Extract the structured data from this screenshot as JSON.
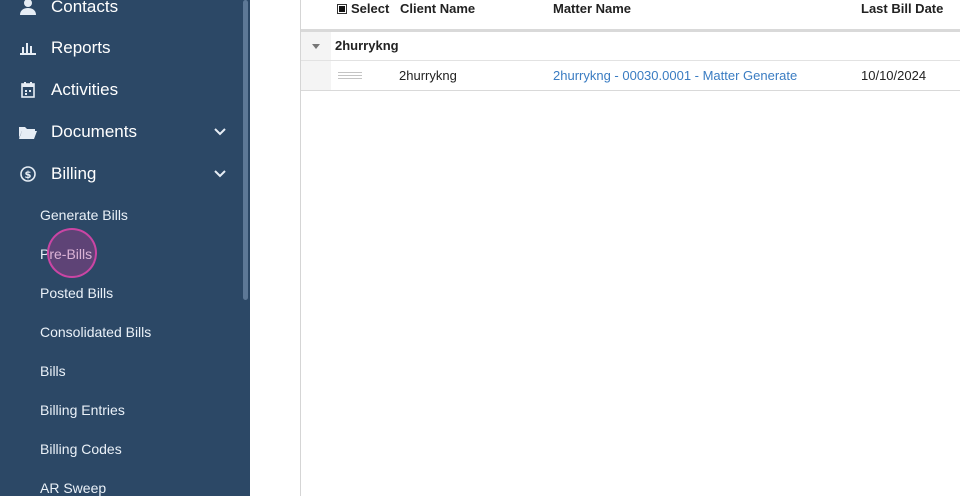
{
  "sidebar": {
    "nav_items": [
      {
        "label": "Contacts",
        "icon": "contacts-icon"
      },
      {
        "label": "Reports",
        "icon": "reports-icon"
      },
      {
        "label": "Activities",
        "icon": "activities-icon"
      },
      {
        "label": "Documents",
        "icon": "folder-icon",
        "expandable": true
      },
      {
        "label": "Billing",
        "icon": "billing-icon",
        "expandable": true
      }
    ],
    "billing_subitems": [
      "Generate Bills",
      "Pre-Bills",
      "Posted Bills",
      "Consolidated Bills",
      "Bills",
      "Billing Entries",
      "Billing Codes",
      "AR Sweep"
    ]
  },
  "grid": {
    "columns": {
      "select": "Select",
      "client_name": "Client Name",
      "matter_name": "Matter Name",
      "last_bill_date": "Last Bill Date"
    },
    "group": {
      "label": "2hurrykng"
    },
    "rows": [
      {
        "client_name": "2hurrykng",
        "matter_name": "2hurrykng - 00030.0001 - Matter Generate",
        "last_bill_date": "10/10/2024"
      }
    ]
  },
  "colors": {
    "sidebar_bg": "#2c4866",
    "link": "#3a7cc2",
    "click_highlight": "#d746aa"
  }
}
